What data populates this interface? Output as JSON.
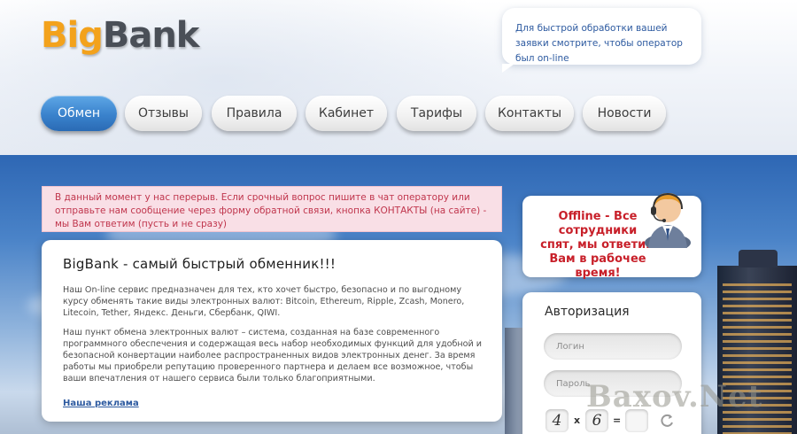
{
  "logo": {
    "big": "Big",
    "bank": "Bank"
  },
  "bubble": {
    "text": "Для быстрой обработки вашей заявки смотрите, чтобы оператор был on-line"
  },
  "nav": [
    {
      "label": "Обмен"
    },
    {
      "label": "Отзывы"
    },
    {
      "label": "Правила"
    },
    {
      "label": "Кабинет"
    },
    {
      "label": "Тарифы"
    },
    {
      "label": "Контакты"
    },
    {
      "label": "Новости"
    }
  ],
  "notice": {
    "text": "В данный момент у нас перерыв. Если срочный вопрос пишите в чат оператору или отправьте нам сообщение через форму обратной связи, кнопка КОНТАКТЫ (на сайте) - мы Вам ответим (пусть и не сразу)"
  },
  "main": {
    "title": "BigBank - самый быстрый обменник!!!",
    "para1": "Наш On-line сервис предназначен для тех, кто хочет быстро, безопасно и по выгодному курсу обменять такие виды электронных валют: Bitcoin, Ethereum, Ripple, Zcash, Monero, Litecoin, Tether, Яндекс. Деньги, Сбербанк, QIWI.",
    "para2": "Наш пункт обмена электронных валют – система, созданная на базе современного программного обеспечения и содержащая весь набор необходимых функций для удобной и безопасной конвертации наиболее распространенных видов электронных денег. За время работы мы приобрели репутацию проверенного партнера и делаем все возможное, чтобы ваши впечатления от нашего сервиса были только благоприятными.",
    "ad_link": "Наша реклама"
  },
  "offline": {
    "text": "Offline - Все сотрудники спят, мы ответим Вам в рабочее время!"
  },
  "auth": {
    "title": "Авторизация",
    "login_placeholder": "Логин",
    "password_placeholder": "Пароль",
    "captcha_a": "4",
    "captcha_op": "x",
    "captcha_b": "6",
    "captcha_eq": "="
  },
  "watermark": "Baxov.Net",
  "colors": {
    "accent": "#3a82cc",
    "notice_text": "#c0364d",
    "offline_text": "#c8202a",
    "logo_orange": "#f3a21c"
  }
}
